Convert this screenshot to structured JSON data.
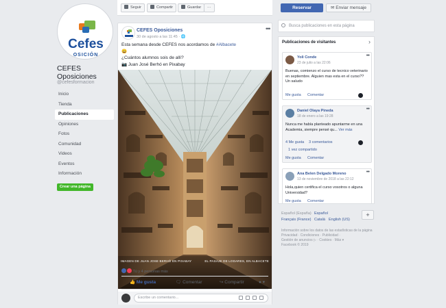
{
  "page": {
    "logo_text": "Cefes",
    "logo_subtext": "OSICIÓN",
    "name": "CEFES Oposiciones",
    "handle": "@cefesformacion",
    "nav": [
      "Inicio",
      "Tienda",
      "Publicaciones",
      "Opiniones",
      "Fotos",
      "Comunidad",
      "Videos",
      "Eventos",
      "Información"
    ],
    "active_nav": "Publicaciones",
    "create_page": "Crear una página"
  },
  "toolbar": {
    "follow": "Seguir",
    "share": "Compartir",
    "save": "Guardar",
    "more": "···"
  },
  "post": {
    "author": "CEFES Oposiciones",
    "date": "30 de agosto a las 11:45 · ",
    "text_line1": "Esta semana desde CEFES nos acordamos de ",
    "hashtag": "#Albacete",
    "emoji": "😀",
    "text_line2": "¿Cuántos alumnos sois de allí?",
    "text_line3": "📷 Juan José Berhó en Pixabay",
    "caption_left": "IMAGEN DE JUAN JOSE BERHÓ EN PIXABAY",
    "caption_right": "EL PASAJE DE LODARES, EN ALBACETE",
    "reactions": "Tú y 4 personas más",
    "like": "Me gusta",
    "comment": "Comentar",
    "share": "Compartir",
    "comment_placeholder": "Escribe un comentario..."
  },
  "sidebar": {
    "reserve": "Reservar",
    "message": "Enviar mensaje",
    "search_placeholder": "Busca publicaciones en esta página",
    "visitors_title": "Publicaciones de visitantes",
    "visitors": [
      {
        "name": "Yoli Conde",
        "date": "23 de julio a las 22:06",
        "text": "Buenas, comienzo el curso de tecnico veterinario en septiembre. Alguien mas esta en el curso?? Un saludo",
        "like": "Me gusta",
        "comment": "Comentar"
      },
      {
        "name": "Daniel Olaya Pineda",
        "date": "18 de enero a las 19:28",
        "text": "Nunca me había planteado apuntarme en una Academia, siempre pensé qu...",
        "more": "Ver más",
        "likes": "4 Me gusta",
        "comments": "3 comentarios",
        "shared": "1 vez compartido",
        "like": "Me gusta",
        "comment": "Comentar"
      },
      {
        "name": "Ana Belen Delgado Moreno",
        "date": "13 de noviembre de 2018 a las 22:12",
        "text": "Hola,quien certifica el curso vosotros o alguna Universidad?",
        "like": "Me gusta",
        "comment": "Comentar"
      }
    ],
    "languages": [
      "Español (España)",
      "Español",
      "Français (France)",
      "Català",
      "English (US)"
    ],
    "footer_line1": "Información sobre los datos de las estadísticas de la página",
    "footer_links1": "Privacidad · Condiciones · Publicidad ·",
    "footer_links2": "Gestión de anuncios ▷ · Cookies · Más ▾",
    "footer_copy": "Facebook © 2019"
  },
  "colors": {
    "fb_blue": "#4267b2",
    "link_blue": "#385898",
    "green": "#42b72a",
    "bg": "#e9ebee"
  }
}
